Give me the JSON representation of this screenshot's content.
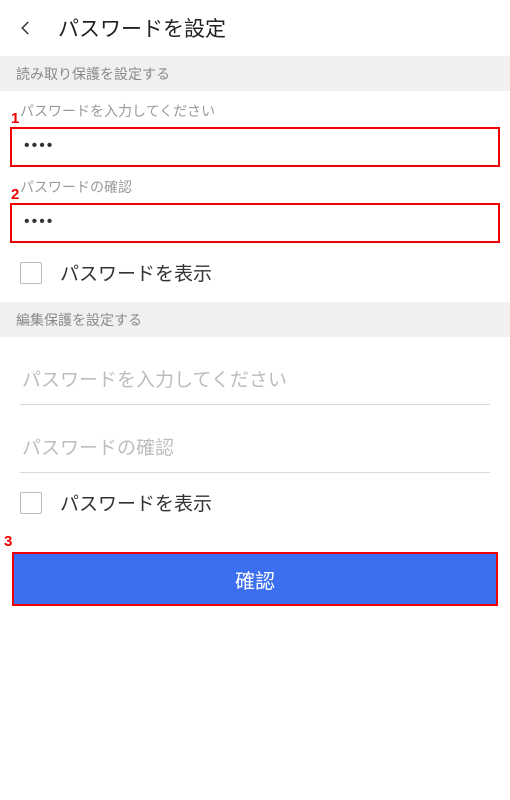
{
  "header": {
    "title": "パスワードを設定"
  },
  "sections": {
    "read_protect": {
      "label": "読み取り保護を設定する",
      "password_label": "パスワードを入力してください",
      "password_value": "••••",
      "confirm_label": "パスワードの確認",
      "confirm_value": "••••",
      "show_password_label": "パスワードを表示"
    },
    "edit_protect": {
      "label": "編集保護を設定する",
      "password_placeholder": "パスワードを入力してください",
      "confirm_placeholder": "パスワードの確認",
      "show_password_label": "パスワードを表示"
    }
  },
  "confirm_button": "確認",
  "annotations": {
    "one": "1",
    "two": "2",
    "three": "3"
  }
}
